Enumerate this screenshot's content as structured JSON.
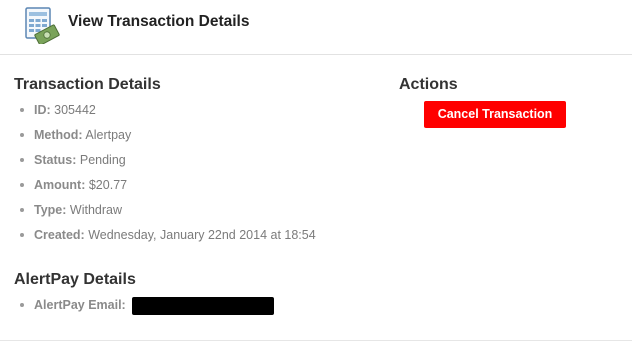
{
  "header": {
    "title": "View Transaction Details",
    "icon": "transaction-details-icon"
  },
  "transaction_details": {
    "title": "Transaction Details",
    "items": [
      {
        "label": "ID:",
        "value": "305442"
      },
      {
        "label": "Method:",
        "value": "Alertpay"
      },
      {
        "label": "Status:",
        "value": "Pending"
      },
      {
        "label": "Amount:",
        "value": "$20.77"
      },
      {
        "label": "Type:",
        "value": "Withdraw"
      },
      {
        "label": "Created:",
        "value": "Wednesday, January 22nd 2014 at 18:54"
      }
    ]
  },
  "actions": {
    "title": "Actions",
    "cancel_label": "Cancel Transaction",
    "cancel_color": "#ff0000"
  },
  "alertpay_details": {
    "title": "AlertPay Details",
    "items": [
      {
        "label": "AlertPay Email:",
        "value": ""
      }
    ]
  }
}
